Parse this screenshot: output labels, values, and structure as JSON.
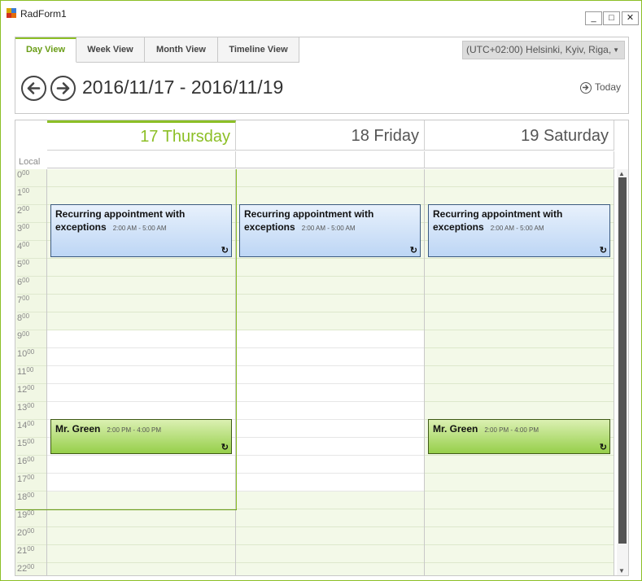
{
  "window": {
    "title": "RadForm1",
    "min_label": "_",
    "max_label": "□",
    "close_label": "✕"
  },
  "tabs": [
    "Day View",
    "Week View",
    "Month View",
    "Timeline View"
  ],
  "timezone": "(UTC+02:00) Helsinki, Kyiv, Riga,",
  "date_range": "2016/11/17 - 2016/11/19",
  "today_label": "Today",
  "local_label": "Local",
  "days": [
    {
      "header": "17 Thursday"
    },
    {
      "header": "18 Friday"
    },
    {
      "header": "19 Saturday"
    }
  ],
  "hours": [
    {
      "h": "0",
      "m": "00"
    },
    {
      "h": "1",
      "m": "00"
    },
    {
      "h": "2",
      "m": "00"
    },
    {
      "h": "3",
      "m": "00"
    },
    {
      "h": "4",
      "m": "00"
    },
    {
      "h": "5",
      "m": "00"
    },
    {
      "h": "6",
      "m": "00"
    },
    {
      "h": "7",
      "m": "00"
    },
    {
      "h": "8",
      "m": "00"
    },
    {
      "h": "9",
      "m": "00"
    },
    {
      "h": "10",
      "m": "00"
    },
    {
      "h": "11",
      "m": "00"
    },
    {
      "h": "12",
      "m": "00"
    },
    {
      "h": "13",
      "m": "00"
    },
    {
      "h": "14",
      "m": "00"
    },
    {
      "h": "15",
      "m": "00"
    },
    {
      "h": "16",
      "m": "00"
    },
    {
      "h": "17",
      "m": "00"
    },
    {
      "h": "18",
      "m": "00"
    },
    {
      "h": "19",
      "m": "00"
    },
    {
      "h": "20",
      "m": "00"
    },
    {
      "h": "21",
      "m": "00"
    },
    {
      "h": "22",
      "m": "00"
    }
  ],
  "appointments": [
    {
      "subject": "Recurring appointment  with exceptions",
      "time": "2:00  AM - 5:00  AM",
      "day": 0,
      "style": "blue"
    },
    {
      "subject": "Recurring appointment  with exceptions",
      "time": "2:00  AM - 5:00  AM",
      "day": 1,
      "style": "blue"
    },
    {
      "subject": "Recurring appointment  with exceptions",
      "time": "2:00  AM - 5:00  AM",
      "day": 2,
      "style": "blue"
    },
    {
      "subject": "Mr. Green",
      "time": "2:00  PM - 4:00  PM",
      "day": 0,
      "style": "green"
    },
    {
      "subject": "Mr. Green",
      "time": "2:00  PM - 4:00  PM",
      "day": 2,
      "style": "green"
    }
  ],
  "recurrence_icon": "↻"
}
